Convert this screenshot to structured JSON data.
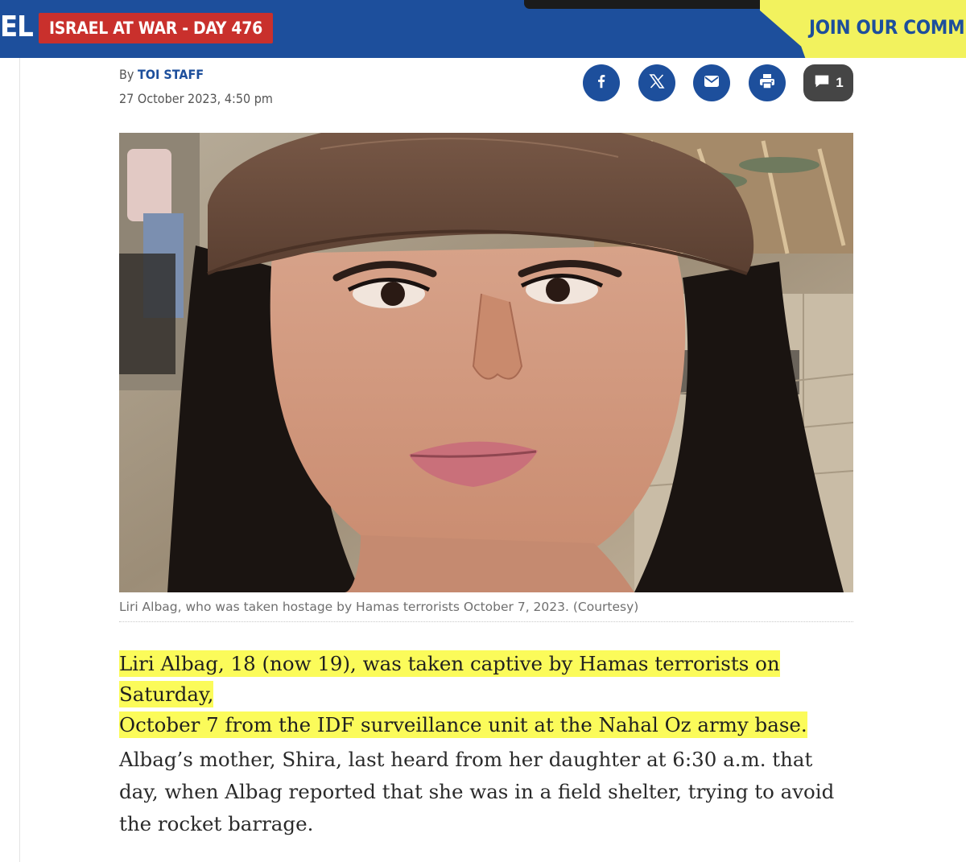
{
  "header": {
    "logo_fragment": "EL",
    "war_badge": "ISRAEL AT WAR - DAY 476",
    "join_banner": "JOIN OUR COMMU"
  },
  "article": {
    "byline_prefix": "By",
    "author": "TOI STAFF",
    "date": "27 October 2023, 4:50 pm",
    "share": {
      "facebook_icon": "facebook-icon",
      "x_icon": "x-icon",
      "email_icon": "email-icon",
      "print_icon": "print-icon",
      "comment_icon": "comment-icon",
      "comment_count": "1"
    },
    "image_caption": "Liri Albag, who was taken hostage by Hamas terrorists October 7, 2023. (Courtesy)",
    "lead_line_1": "Liri Albag, 18 (now 19), was taken captive by Hamas terrorists on Saturday,",
    "lead_line_2": "October 7 from the IDF surveillance unit at the Nahal Oz army base.",
    "paragraph_2": "Albag’s mother, Shira, last heard from her daughter at 6:30 a.m. that day, when Albag reported that she was in a field shelter, trying to avoid the rocket barrage."
  },
  "colors": {
    "brand_blue": "#1d4f9c",
    "badge_red": "#c9302c",
    "banner_yellow": "#f2f25e",
    "highlight_yellow": "#fbfb5a"
  }
}
